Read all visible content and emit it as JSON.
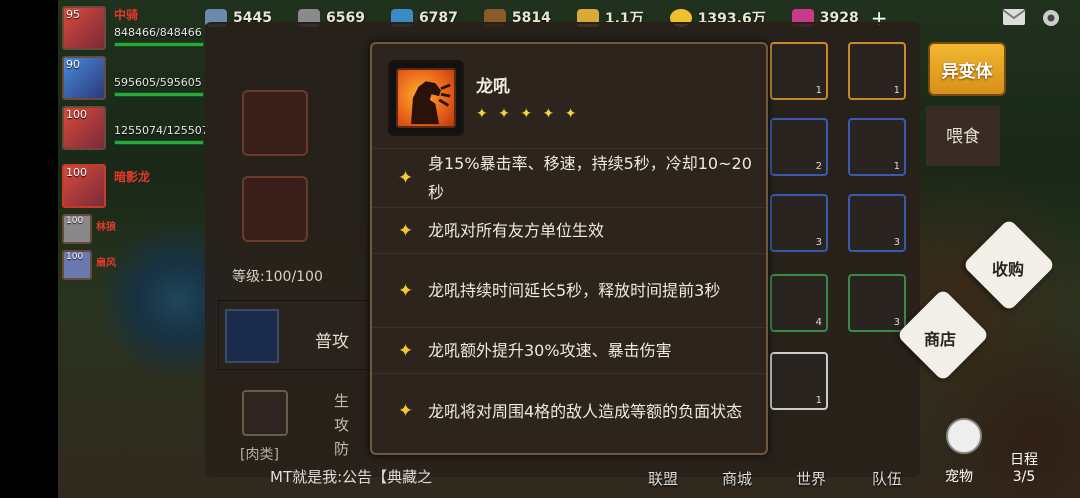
{
  "resources": [
    {
      "icon": "coin-icon",
      "value": "5445"
    },
    {
      "icon": "stone-icon",
      "value": "6569"
    },
    {
      "icon": "crystal-icon",
      "value": "6787"
    },
    {
      "icon": "wood-icon",
      "value": "5814"
    },
    {
      "icon": "grain-icon",
      "value": "1.1万"
    },
    {
      "icon": "gold-icon",
      "value": "1393.6万"
    },
    {
      "icon": "gem-icon",
      "value": "3928"
    }
  ],
  "party": [
    {
      "level": "95",
      "name": "中骑",
      "hp": "848466/848466"
    },
    {
      "level": "90",
      "name": "",
      "hp": "595605/595605"
    },
    {
      "level": "100",
      "name": "",
      "hp": "1255074/125507"
    },
    {
      "level": "100",
      "name": "暗影龙",
      "hp": ""
    },
    {
      "level": "100",
      "name": "林狼",
      "hp": ""
    },
    {
      "level": "100",
      "name": "扇风",
      "hp": ""
    }
  ],
  "panel": {
    "grade_label": "等级:100/100",
    "attack_label": "普攻",
    "food_label": "[肉类]",
    "stats": [
      "生",
      "攻",
      "防"
    ]
  },
  "tooltip": {
    "title": "龙吼",
    "stars": "✦ ✦ ✦ ✦ ✦",
    "effects": [
      "身15%暴击率、移速，持续5秒，冷却10~20秒",
      "龙吼对所有友方单位生效",
      "龙吼持续时间延长5秒，释放时间提前3秒",
      "龙吼额外提升30%攻速、暴击伤害",
      "龙吼将对周围4格的敌人造成等额的负面状态"
    ]
  },
  "right": {
    "mutant": "异变体",
    "feed": "喂食",
    "buy": "收购",
    "shop": "商店",
    "pet": "宠物",
    "schedule": "日程",
    "schedule_count": "3/5"
  },
  "bag_counts": [
    "1",
    "1",
    "2",
    "1",
    "3",
    "3",
    "4",
    "3",
    "1"
  ],
  "bottom_nav": [
    "联盟",
    "商城",
    "世界",
    "队伍"
  ],
  "chat": "MT就是我:公告【典藏之"
}
